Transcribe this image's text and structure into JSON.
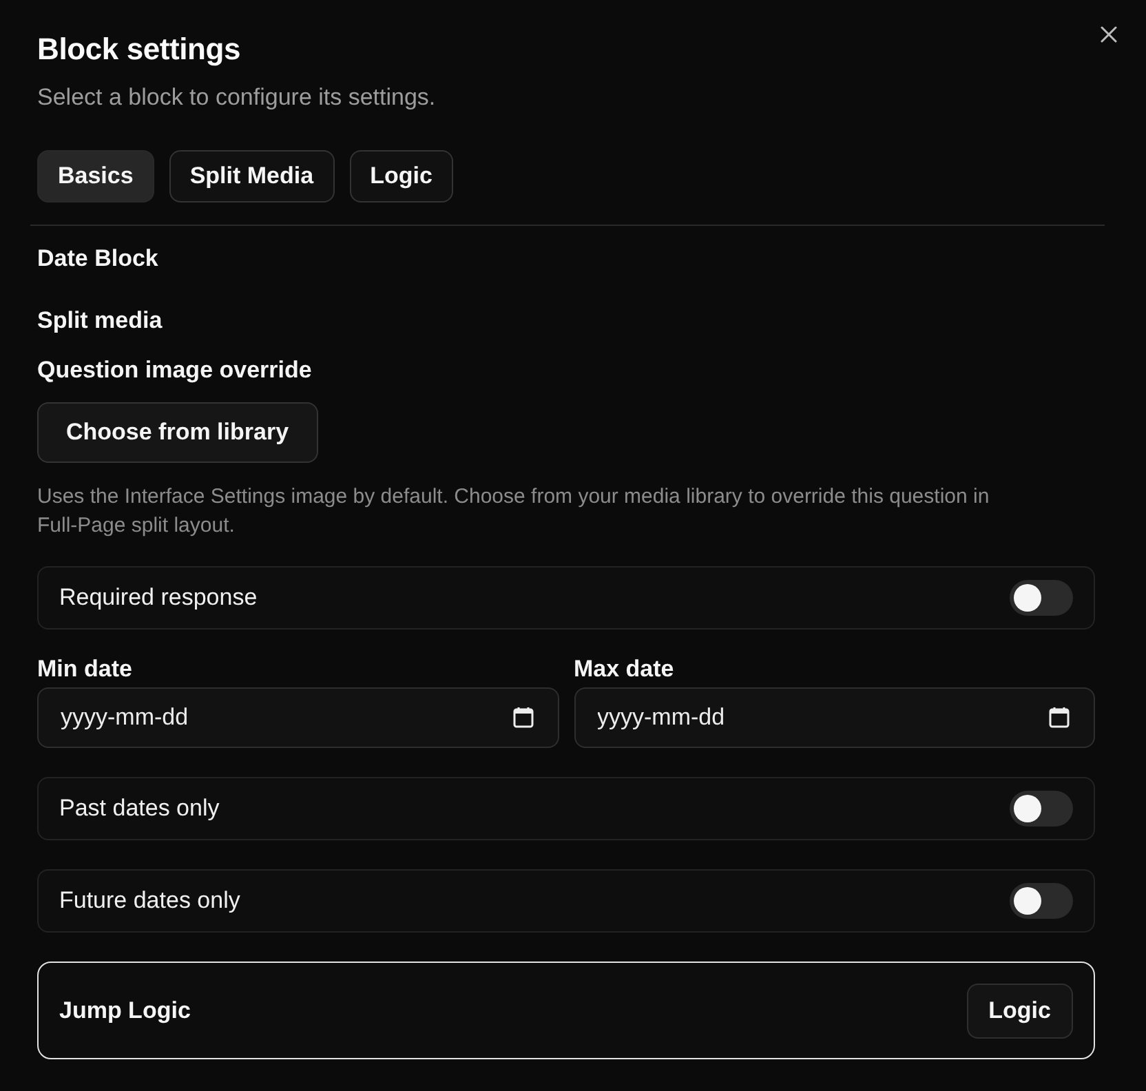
{
  "dialog": {
    "title": "Block settings",
    "subtitle": "Select a block to configure its settings."
  },
  "tabs": [
    {
      "label": "Basics",
      "selected": true
    },
    {
      "label": "Split Media",
      "selected": false
    },
    {
      "label": "Logic",
      "selected": false
    }
  ],
  "block_type": "Date Block",
  "split_media": {
    "heading": "Split media",
    "label": "Question image override",
    "button": "Choose from library",
    "help": "Uses the Interface Settings image by default. Choose from your media library to override this question in Full-Page split layout."
  },
  "settings": [
    {
      "kind": "toggle",
      "label": "Required response",
      "on": false
    },
    {
      "kind": "dates",
      "fields": [
        {
          "label": "Min date",
          "placeholder": "yyyy-mm-dd"
        },
        {
          "label": "Max date",
          "placeholder": "yyyy-mm-dd"
        }
      ]
    },
    {
      "kind": "toggle",
      "label": "Past dates only",
      "on": false
    },
    {
      "kind": "toggle",
      "label": "Future dates only",
      "on": false
    },
    {
      "kind": "link",
      "label": "Jump Logic",
      "button": "Logic"
    }
  ]
}
